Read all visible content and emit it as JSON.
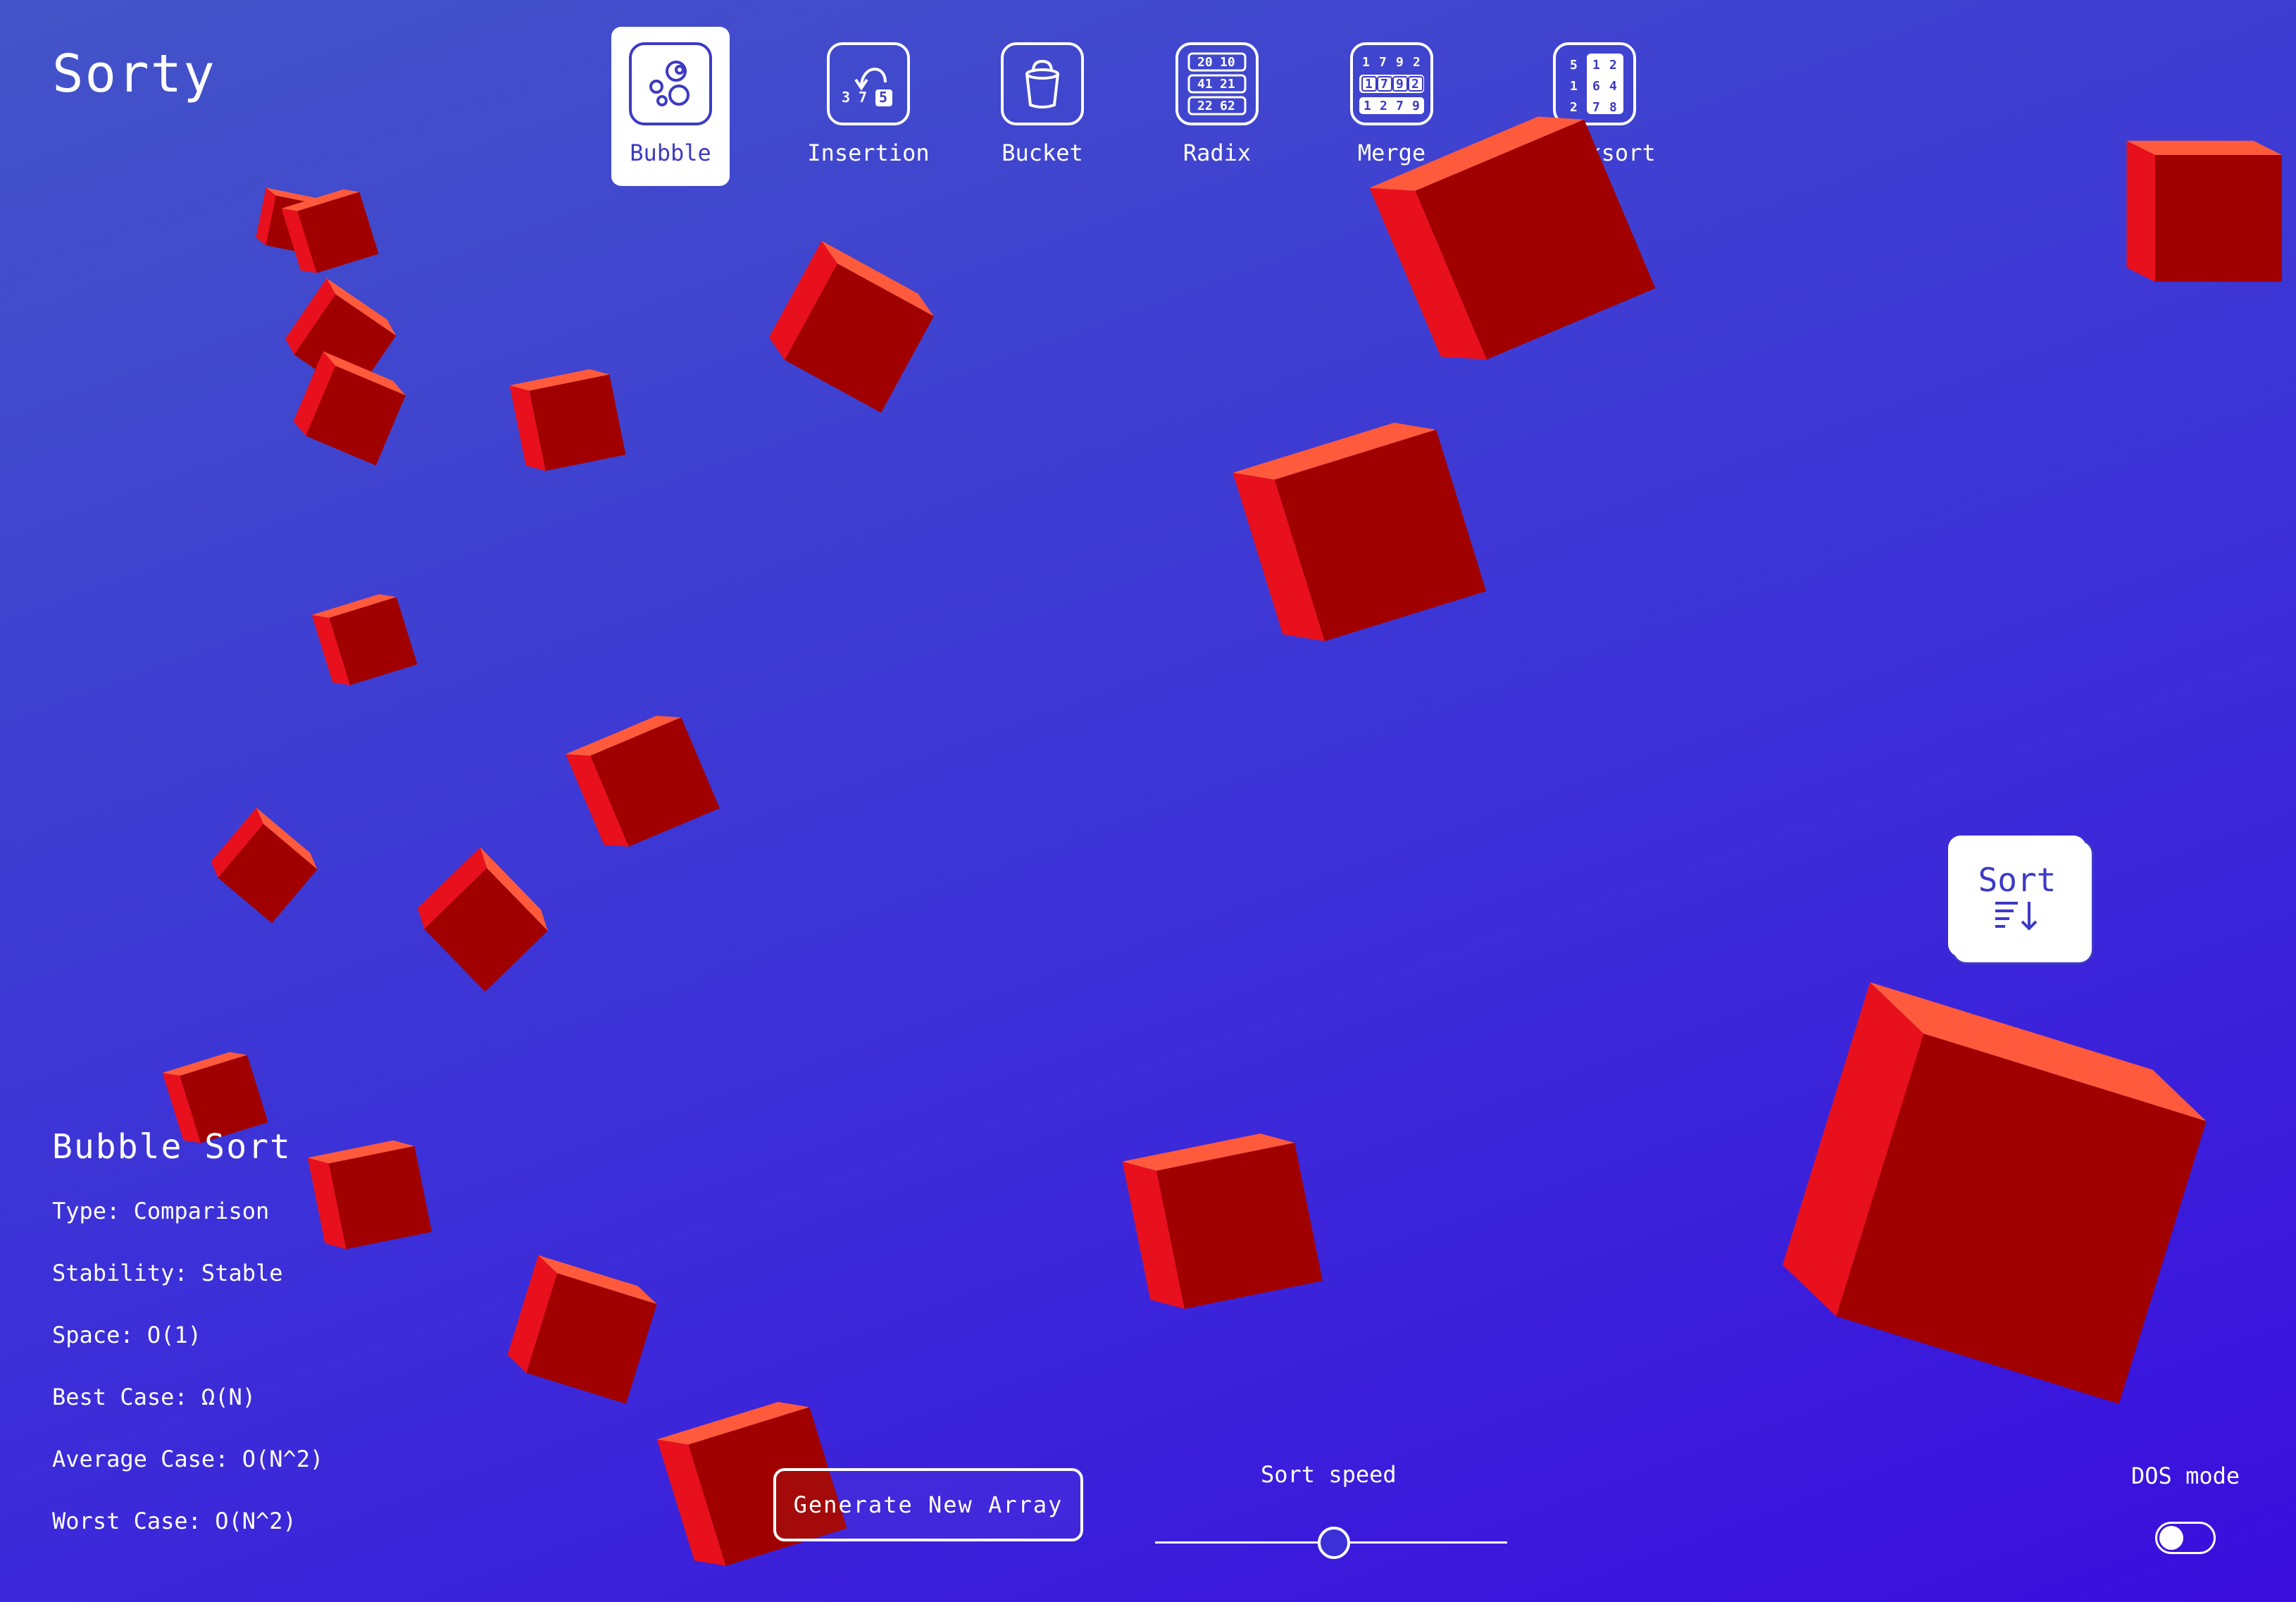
{
  "app": {
    "title": "Sorty"
  },
  "nav": {
    "items": [
      {
        "label": "Bubble",
        "icon": "bubbles-icon",
        "active": true
      },
      {
        "label": "Insertion",
        "icon": "insertion-arrow-icon",
        "active": false
      },
      {
        "label": "Bucket",
        "icon": "bucket-icon",
        "active": false
      },
      {
        "label": "Radix",
        "icon": "radix-grid-icon",
        "active": false
      },
      {
        "label": "Merge",
        "icon": "merge-grid-icon",
        "active": false
      },
      {
        "label": "Quicksort",
        "icon": "quicksort-grid-icon",
        "active": false
      }
    ],
    "insertion_digits": [
      "3",
      "7",
      "5"
    ],
    "radix_rows": [
      [
        "20",
        "10"
      ],
      [
        "41",
        "21"
      ],
      [
        "22",
        "62"
      ]
    ],
    "merge_rows": [
      [
        "1",
        "7",
        "9",
        "2"
      ],
      [
        "1",
        "7",
        "9",
        "2"
      ],
      [
        "1",
        "2",
        "7",
        "9"
      ]
    ],
    "quick_rows": [
      [
        "5",
        "1",
        "2"
      ],
      [
        "1",
        "6",
        "4"
      ],
      [
        "2",
        "7",
        "8"
      ]
    ]
  },
  "algorithm": {
    "title": "Bubble Sort",
    "type": "Type: Comparison",
    "stability": "Stability: Stable",
    "space": "Space: O(1)",
    "best": "Best Case: Ω(N)",
    "average": "Average Case: O(N^2)",
    "worst": "Worst Case: O(N^2)"
  },
  "controls": {
    "sort_label": "Sort",
    "generate_label": "Generate New Array",
    "speed_label": "Sort speed",
    "speed_value": 0.5,
    "dos_label": "DOS mode",
    "dos_on": false
  },
  "colors": {
    "accent": "#3d3ac4",
    "cube_front": "#a10000",
    "cube_top": "#ff5a3c",
    "cube_side": "#e8101c"
  }
}
